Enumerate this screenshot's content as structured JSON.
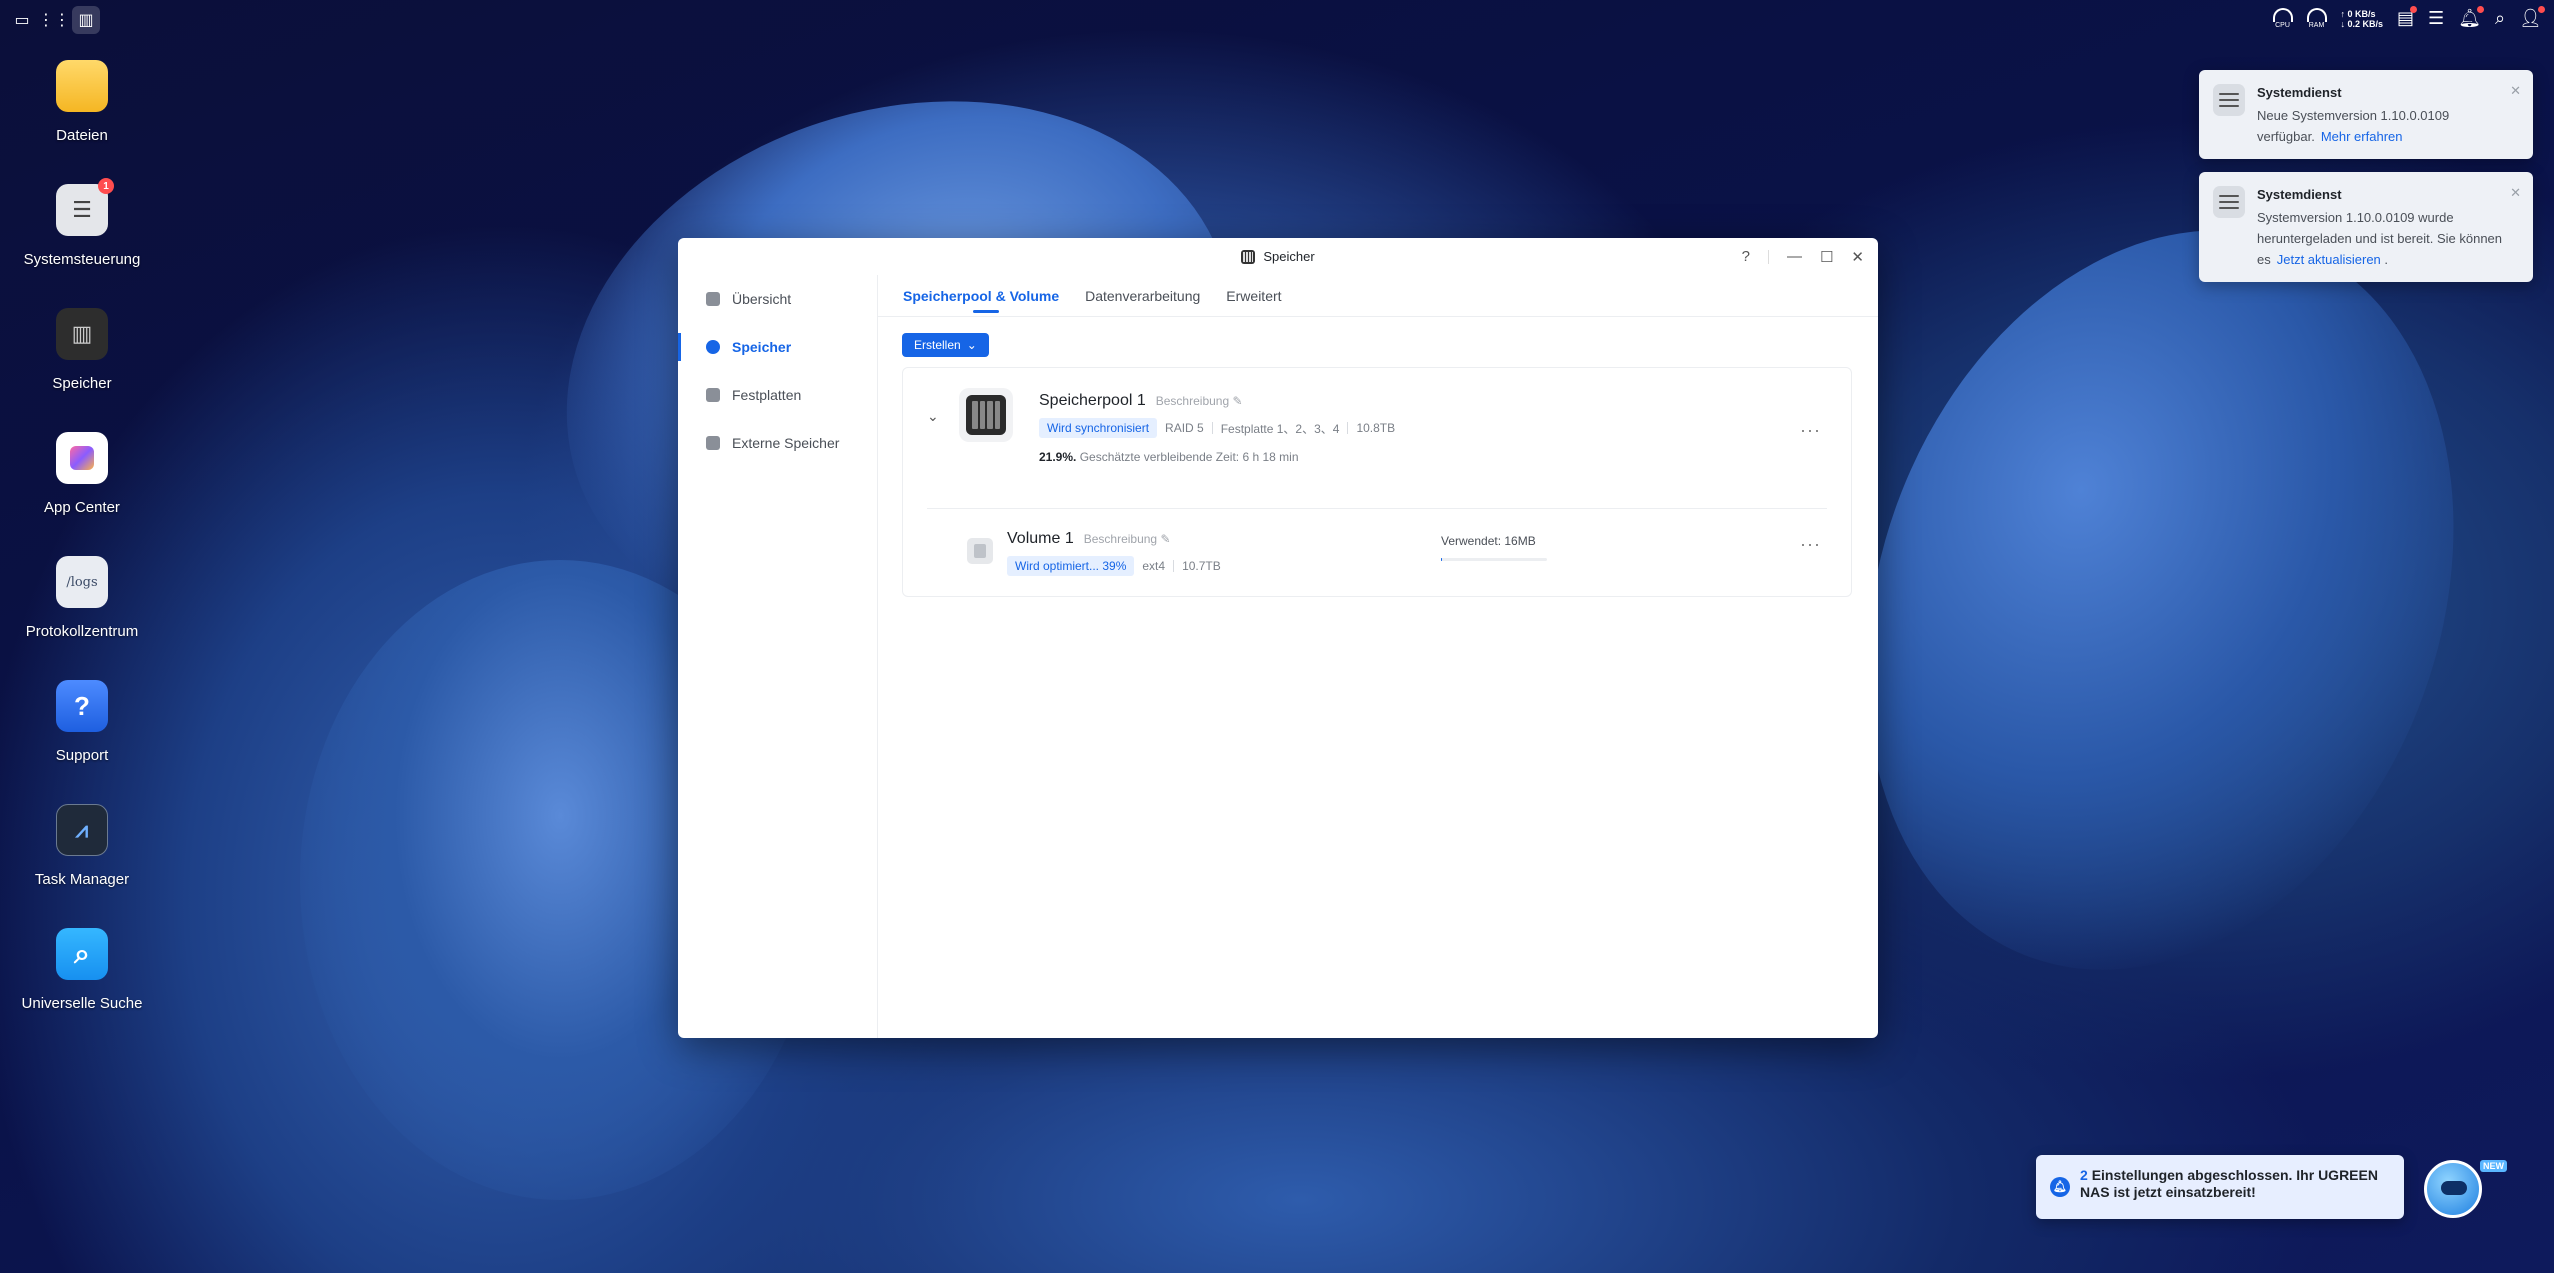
{
  "topbar": {
    "cpu_label": "CPU",
    "ram_label": "RAM",
    "upload": "↑ 0 KB/s",
    "download": "↓ 0.2 KB/s"
  },
  "desktop": {
    "icons": [
      {
        "label": "Dateien"
      },
      {
        "label": "Systemsteuerung",
        "badge": "1"
      },
      {
        "label": "Speicher"
      },
      {
        "label": "App Center"
      },
      {
        "label": "Protokollzentrum",
        "glyph": "/logs"
      },
      {
        "label": "Support",
        "glyph": "?"
      },
      {
        "label": "Task Manager"
      },
      {
        "label": "Universelle Suche"
      }
    ]
  },
  "window": {
    "title": "Speicher",
    "help": "?",
    "sidebar": [
      {
        "label": "Übersicht"
      },
      {
        "label": "Speicher"
      },
      {
        "label": "Festplatten"
      },
      {
        "label": "Externe Speicher"
      }
    ],
    "tabs": [
      {
        "label": "Speicherpool & Volume"
      },
      {
        "label": "Datenverarbeitung"
      },
      {
        "label": "Erweitert"
      }
    ],
    "create_button": "Erstellen",
    "pool": {
      "name": "Speicherpool 1",
      "description": "Beschreibung",
      "status": "Wird synchronisiert",
      "raid": "RAID 5",
      "disks": "Festplatte 1、2、3、4",
      "capacity": "10.8TB",
      "progress": "21.9%.",
      "remaining": "Geschätzte verbleibende Zeit: 6 h 18 min"
    },
    "volume": {
      "name": "Volume 1",
      "description": "Beschreibung",
      "status": "Wird optimiert... 39%",
      "fs": "ext4",
      "capacity": "10.7TB",
      "used": "Verwendet: 16MB",
      "used_fraction": 0.01
    }
  },
  "notifications": [
    {
      "title": "Systemdienst",
      "body": "Neue Systemversion 1.10.0.0109 verfügbar.",
      "link": "Mehr erfahren"
    },
    {
      "title": "Systemdienst",
      "body": "Systemversion 1.10.0.0109 wurde heruntergeladen und ist bereit. Sie können es",
      "link": "Jetzt aktualisieren",
      "trail": "."
    }
  ],
  "toast": {
    "count": "2",
    "text": "Einstellungen abgeschlossen. Ihr UGREEN NAS ist jetzt einsatzbereit!",
    "robot_tag": "NEW"
  },
  "colors": {
    "accent": "#1665e6",
    "badge": "#ff4d4f"
  }
}
